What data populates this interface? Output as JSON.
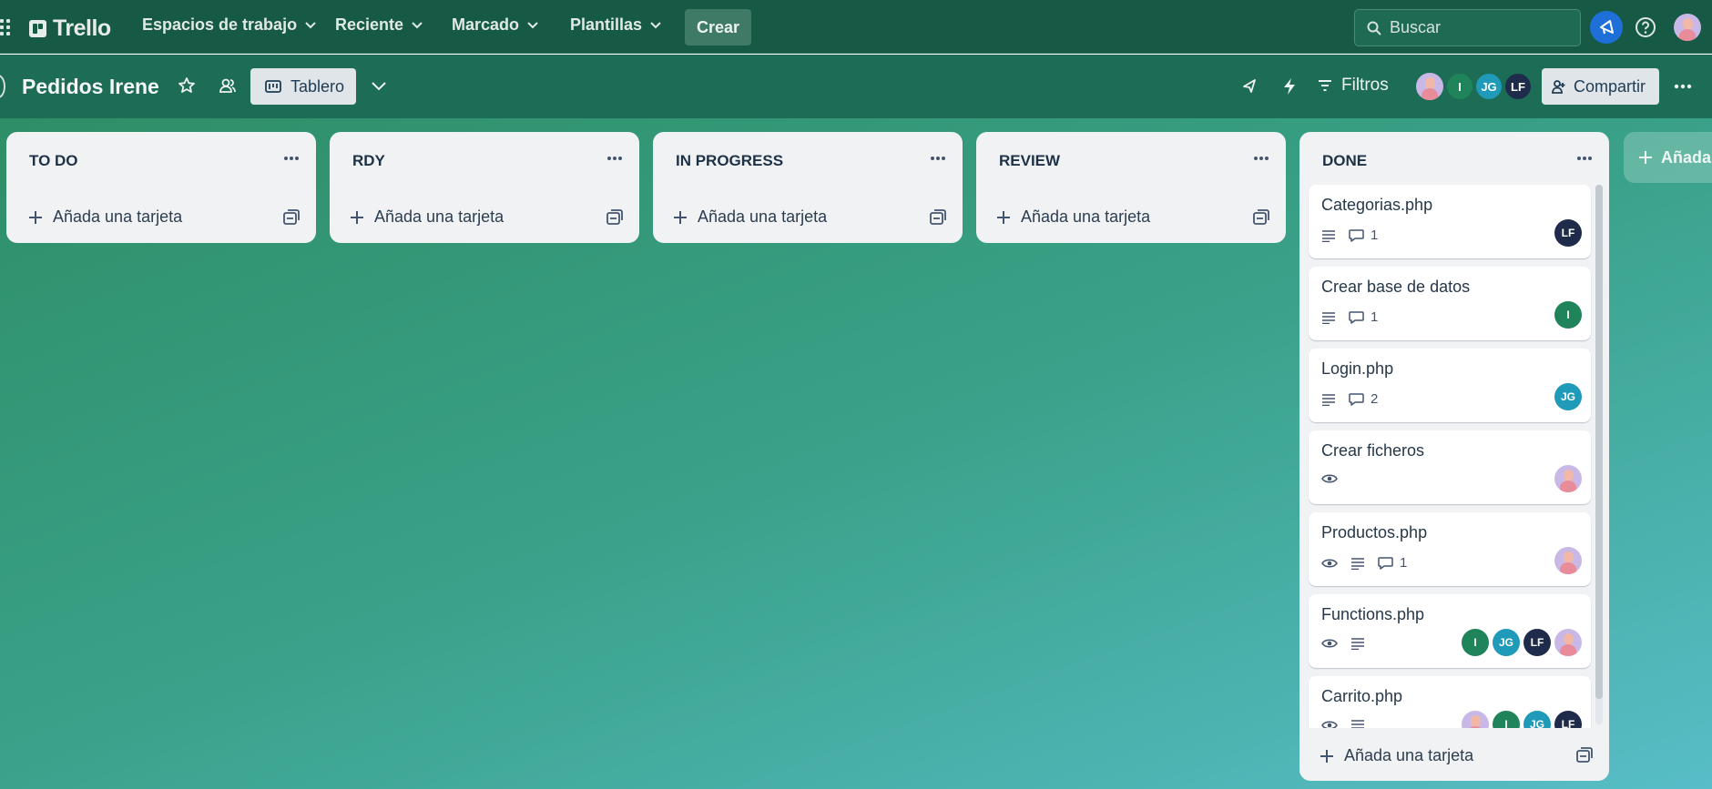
{
  "topnav": {
    "logo": "Trello",
    "menus": [
      "Espacios de trabajo",
      "Reciente",
      "Marcado",
      "Plantillas"
    ],
    "create_label": "Crear",
    "search_placeholder": "Buscar"
  },
  "board": {
    "title": "Pedidos Irene",
    "view_label": "Tablero",
    "filter_label": "Filtros",
    "share_label": "Compartir",
    "members": [
      "I",
      "JG",
      "LF"
    ]
  },
  "lists": [
    {
      "title": "TO DO",
      "add_label": "Añada una tarjeta"
    },
    {
      "title": "RDY",
      "add_label": "Añada una tarjeta"
    },
    {
      "title": "IN PROGRESS",
      "add_label": "Añada una tarjeta"
    },
    {
      "title": "REVIEW",
      "add_label": "Añada una tarjeta"
    },
    {
      "title": "DONE",
      "add_label": "Añada una tarjeta",
      "cards": [
        {
          "title": "Categorias.php",
          "comments": "1",
          "members": [
            "LF"
          ]
        },
        {
          "title": "Crear base de datos",
          "comments": "1",
          "members": [
            "I"
          ]
        },
        {
          "title": "Login.php",
          "comments": "2",
          "members": [
            "JG"
          ]
        },
        {
          "title": "Crear ficheros",
          "members": []
        },
        {
          "title": "Productos.php",
          "comments": "1",
          "members": []
        },
        {
          "title": "Functions.php",
          "members": [
            "I",
            "JG",
            "LF"
          ]
        },
        {
          "title": "Carrito.php",
          "members": [
            "I",
            "JG",
            "LF"
          ]
        }
      ]
    }
  ],
  "add_list_label": "Añada",
  "colors": {
    "member_I": "#1f845a",
    "member_JG": "#1f9ab8",
    "member_LF": "#1e2b4a",
    "notif": "#1f6fd8"
  }
}
